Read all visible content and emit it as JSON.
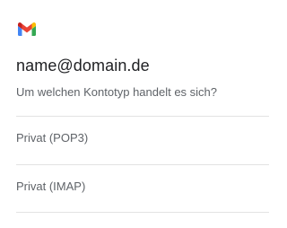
{
  "header": {
    "logo_icon": "gmail-icon",
    "account_email": "name@domain.de",
    "prompt": "Um welchen Kontotyp handelt es sich?"
  },
  "options": [
    {
      "label": "Privat (POP3)"
    },
    {
      "label": "Privat (IMAP)"
    }
  ],
  "colors": {
    "gmail_red": "#EA4335",
    "gmail_blue": "#4285F4",
    "gmail_green": "#34A853",
    "gmail_yellow": "#FBBC04",
    "gmail_dark_red": "#C5221F",
    "primary_text": "#202124",
    "secondary_text": "#5f6368",
    "divider": "#e3e3e3"
  }
}
